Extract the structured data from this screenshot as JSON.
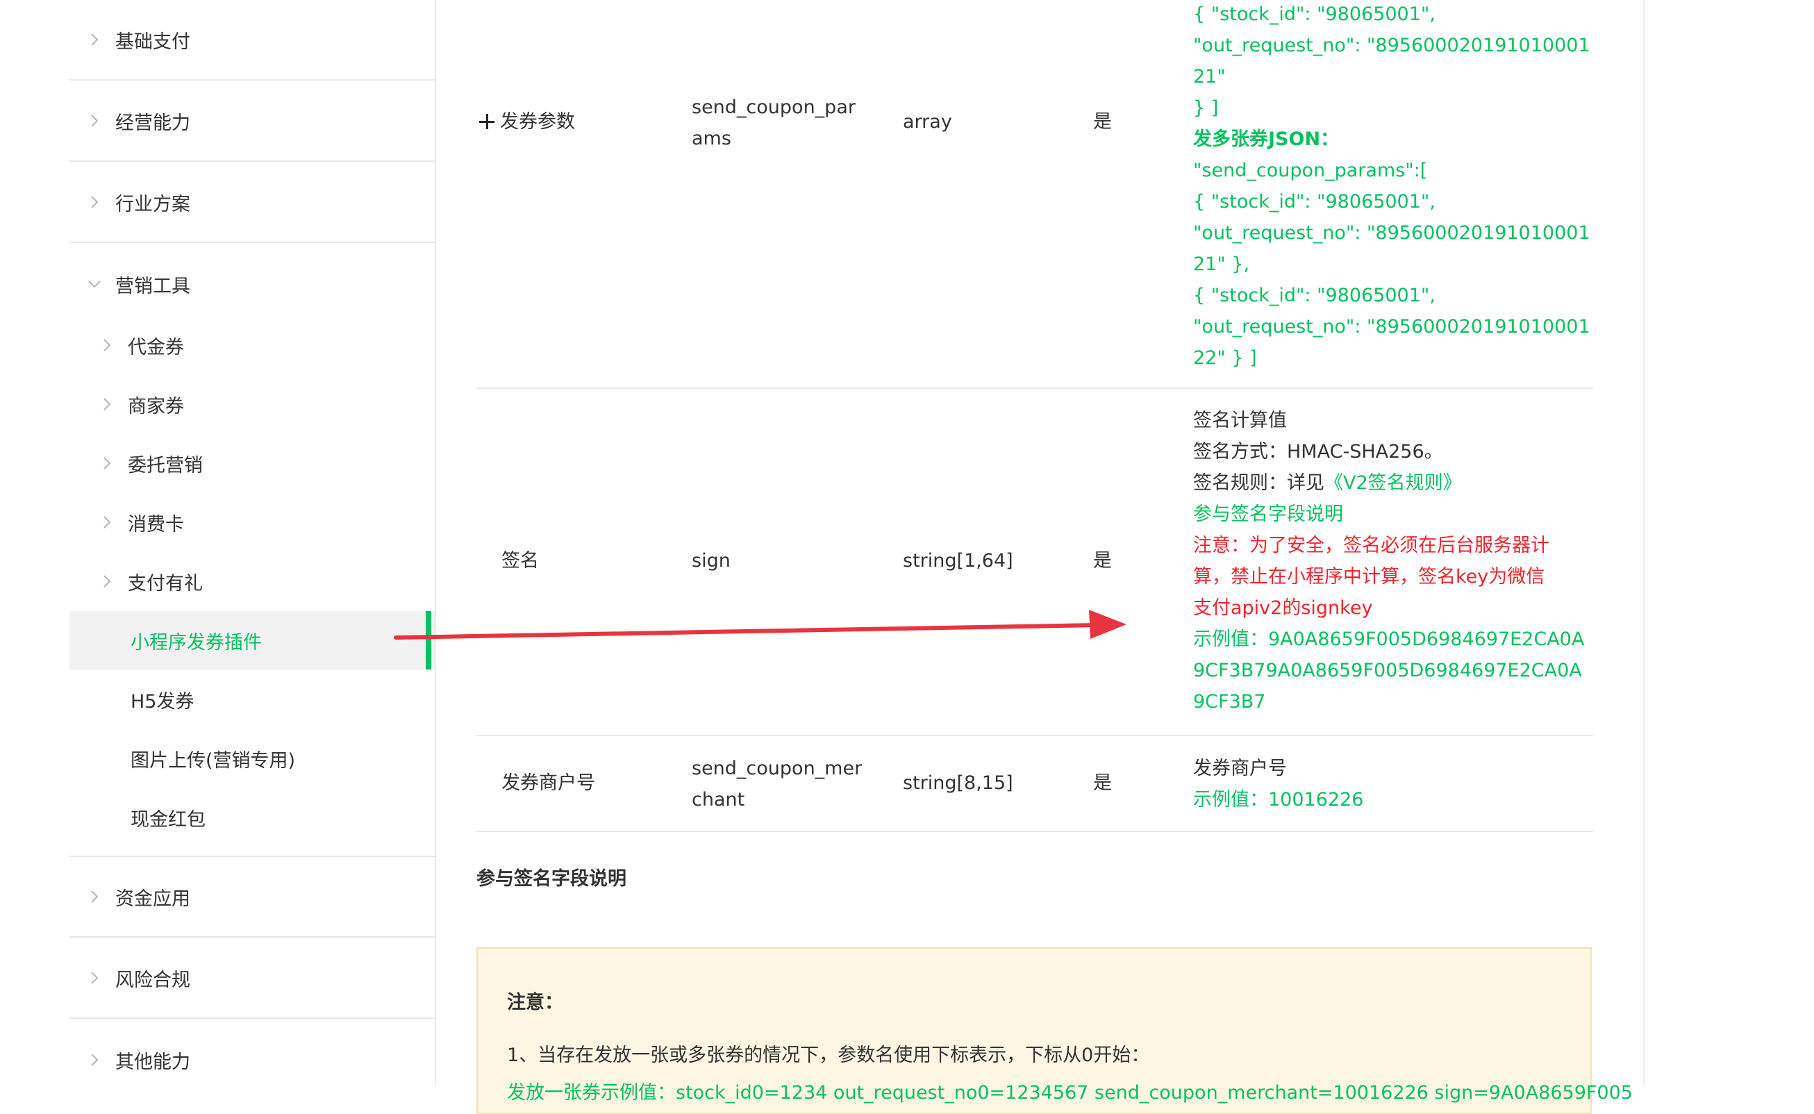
{
  "sidebar": {
    "top": [
      {
        "label": "基础支付"
      },
      {
        "label": "经营能力"
      },
      {
        "label": "行业方案"
      },
      {
        "label": "营销工具"
      }
    ],
    "marketing": [
      {
        "label": "代金券"
      },
      {
        "label": "商家券"
      },
      {
        "label": "委托营销"
      },
      {
        "label": "消费卡"
      },
      {
        "label": "支付有礼"
      },
      {
        "label": "小程序发券插件"
      },
      {
        "label": "H5发券"
      },
      {
        "label": "图片上传(营销专用)"
      },
      {
        "label": "现金红包"
      }
    ],
    "bottom": [
      {
        "label": "资金应用"
      },
      {
        "label": "风险合规"
      },
      {
        "label": "其他能力"
      }
    ],
    "active_color": "#07c160"
  },
  "params": {
    "row1": {
      "name": "发券参数",
      "field_a": "send_coupon_par",
      "field_b": "ams",
      "type": "array",
      "required": "是",
      "desc": [
        "{ \"stock_id\": \"98065001\",",
        "\"out_request_no\": \"895600020191010001",
        "21\"",
        "} ]",
        "发多张券JSON：",
        "\"send_coupon_params\":[",
        "{ \"stock_id\": \"98065001\",",
        "\"out_request_no\": \"895600020191010001",
        "21\" },",
        "{ \"stock_id\": \"98065001\",",
        "\"out_request_no\": \"895600020191010001",
        "22\" } ]"
      ]
    },
    "row2": {
      "name": "签名",
      "field": "sign",
      "type": "string[1,64]",
      "required": "是",
      "desc_l1": "签名计算值",
      "desc_l2": "签名方式：HMAC-SHA256。",
      "desc_l3_prefix": "签名规则：详见",
      "desc_l3_link": "《V2签名规则》",
      "desc_l4": "参与签名字段说明",
      "desc_l5": "注意：为了安全，签名必须在后台服务器计",
      "desc_l6": "算，禁止在小程序中计算，签名key为微信",
      "desc_l7": "支付apiv2的signkey",
      "desc_l8": "示例值：9A0A8659F005D6984697E2CA0A",
      "desc_l9": "9CF3B79A0A8659F005D6984697E2CA0A",
      "desc_l10": "9CF3B7"
    },
    "row3": {
      "name": "发券商户号",
      "field_a": "send_coupon_mer",
      "field_b": "chant",
      "type": "string[8,15]",
      "required": "是",
      "desc_l1": "发券商户号",
      "desc_l2": "示例值：10016226"
    }
  },
  "section_title": "参与签名字段说明",
  "notice": {
    "title": "注意：",
    "text": "1、当存在发放一张或多张券的情况下，参数名使用下标表示，下标从0开始：",
    "peek": "发放一张券示例值：stock_id0=1234 out_request_no0=1234567 send_coupon_merchant=10016226 sign=9A0A8659F005"
  },
  "colors": {
    "green": "#07c160",
    "red": "#f5222d",
    "arrow": "#e8343f"
  }
}
